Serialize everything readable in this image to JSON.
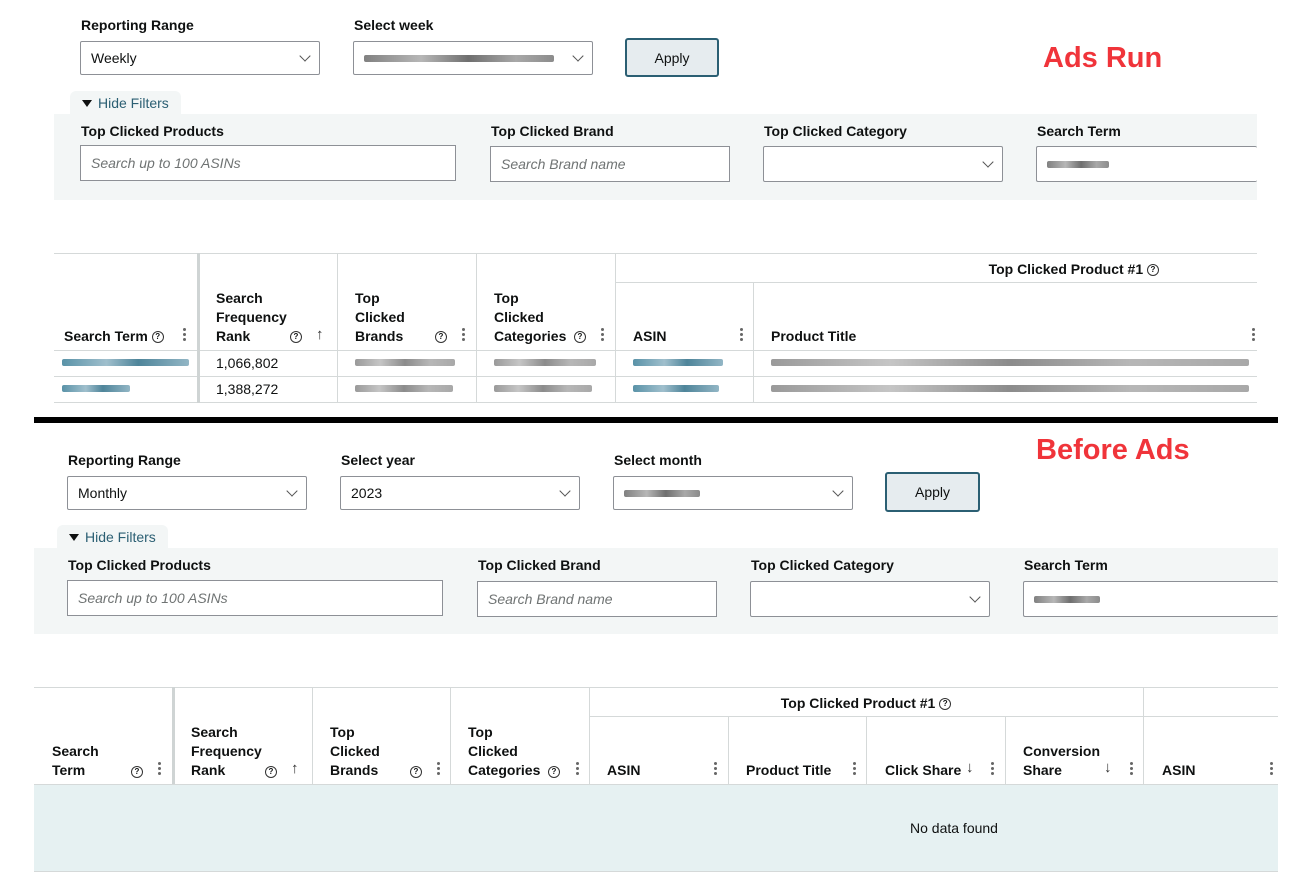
{
  "top": {
    "annotation": "Ads Run",
    "reporting_range_label": "Reporting Range",
    "reporting_range_value": "Weekly",
    "select_week_label": "Select week",
    "apply": "Apply",
    "hide_filters": "Hide Filters",
    "filters": {
      "products_label": "Top Clicked Products",
      "products_placeholder": "Search up to 100 ASINs",
      "brand_label": "Top Clicked Brand",
      "brand_placeholder": "Search Brand name",
      "category_label": "Top Clicked Category",
      "search_term_label": "Search Term"
    },
    "table": {
      "group_header": "Top Clicked Product #1",
      "col_search_term": "Search Term",
      "col_sfr": [
        "Search",
        "Frequency",
        "Rank"
      ],
      "col_brands": [
        "Top",
        "Clicked",
        "Brands"
      ],
      "col_categories": [
        "Top",
        "Clicked",
        "Categories"
      ],
      "col_asin": "ASIN",
      "col_title": "Product Title",
      "rows": [
        {
          "rank": "1,066,802"
        },
        {
          "rank": "1,388,272"
        }
      ]
    }
  },
  "bottom": {
    "annotation": "Before Ads",
    "reporting_range_label": "Reporting Range",
    "reporting_range_value": "Monthly",
    "select_year_label": "Select year",
    "select_year_value": "2023",
    "select_month_label": "Select month",
    "apply": "Apply",
    "hide_filters": "Hide Filters",
    "filters": {
      "products_label": "Top Clicked Products",
      "products_placeholder": "Search up to 100 ASINs",
      "brand_label": "Top Clicked Brand",
      "brand_placeholder": "Search Brand name",
      "category_label": "Top Clicked Category",
      "search_term_label": "Search Term"
    },
    "table": {
      "group_header": "Top Clicked Product #1",
      "col_search_term": [
        "Search",
        "Term"
      ],
      "col_sfr": [
        "Search",
        "Frequency",
        "Rank"
      ],
      "col_brands": [
        "Top",
        "Clicked",
        "Brands"
      ],
      "col_categories": [
        "Top",
        "Clicked",
        "Categories"
      ],
      "col_asin": "ASIN",
      "col_title": "Product Title",
      "col_click_share": "Click Share",
      "col_conversion_share": [
        "Conversion",
        "Share"
      ],
      "col_asin2": "ASIN",
      "empty_message": "No data found"
    }
  },
  "colors": {
    "annotation_red": "#f0343a",
    "accent_teal": "#2b5f73",
    "panel_bg": "#f3f6f6",
    "empty_bg": "#e6f1f2"
  }
}
